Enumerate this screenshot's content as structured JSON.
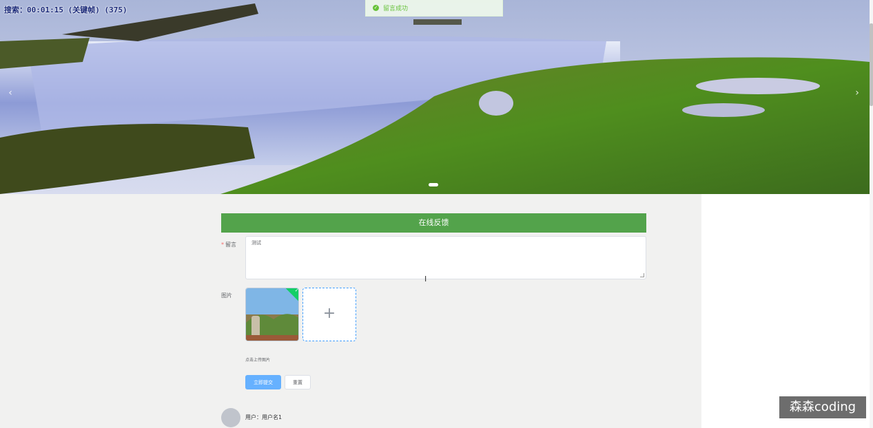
{
  "recording": {
    "text": "搜索：00:01:15 (关键帧) (375)"
  },
  "toast": {
    "icon": "check-circle-icon",
    "message": "留言成功"
  },
  "banner": {
    "prev_icon": "chevron-left-icon",
    "next_icon": "chevron-right-icon",
    "active_slide": 1
  },
  "form": {
    "header": "在线反馈",
    "message_label": "留言",
    "message_required": "*",
    "message_value": "测试",
    "image_label": "图片",
    "upload_plus": "+",
    "upload_hint": "点击上传图片",
    "submit_label": "立即提交",
    "reset_label": "重置"
  },
  "comment": {
    "user_text": "用户：用户名1"
  },
  "watermark": {
    "text": "森森coding"
  },
  "colors": {
    "header": "#53a34b",
    "primary": "#66b1ff",
    "success": "#67c23a"
  }
}
